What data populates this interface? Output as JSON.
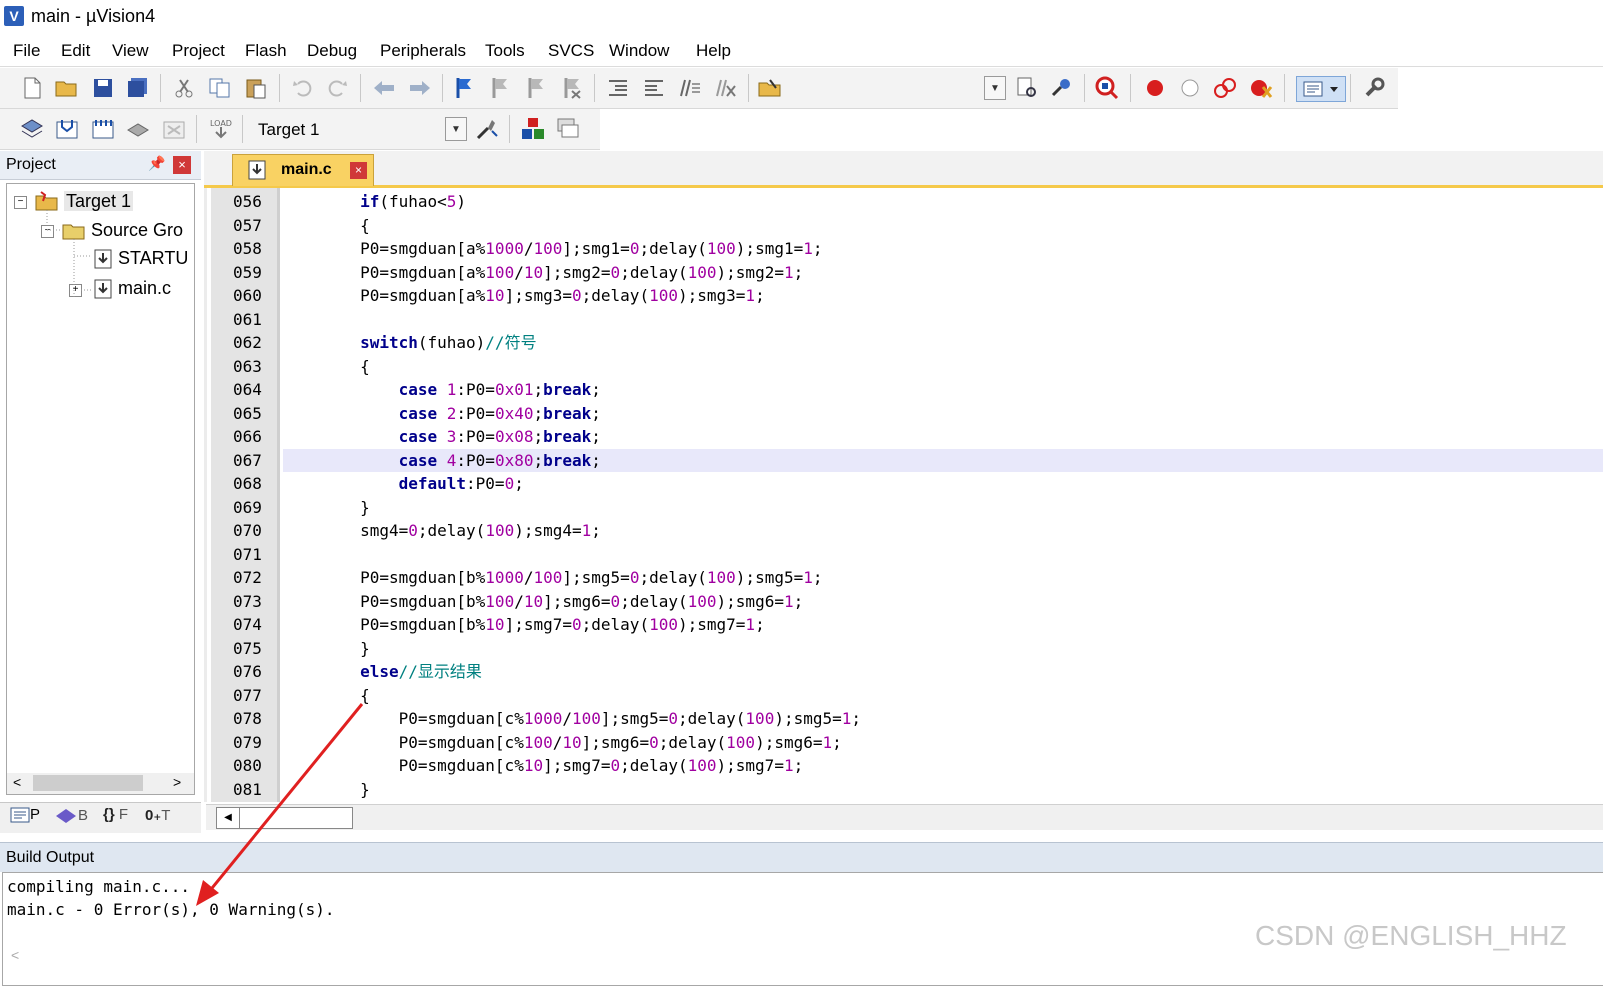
{
  "window": {
    "title": "main  - µVision4"
  },
  "menu": [
    "File",
    "Edit",
    "View",
    "Project",
    "Flash",
    "Debug",
    "Peripherals",
    "Tools",
    "SVCS",
    "Window",
    "Help"
  ],
  "toolbar2": {
    "target": "Target 1",
    "load_label": "LOAD"
  },
  "project_panel": {
    "title": "Project",
    "tree": [
      {
        "label": "Target 1"
      },
      {
        "label": "Source Gro"
      },
      {
        "label": "STARTU"
      },
      {
        "label": "main.c"
      }
    ],
    "tabs": [
      {
        "label": "P"
      },
      {
        "label": "B"
      },
      {
        "label": "F"
      },
      {
        "label": "T"
      }
    ]
  },
  "editor": {
    "tab_label": "main.c",
    "lines": [
      {
        "no": "056",
        "html": "        <span class=\"kw\">if</span>(fuhao&lt;<span class=\"num\">5</span>)"
      },
      {
        "no": "057",
        "html": "        {"
      },
      {
        "no": "058",
        "html": "        P0=smgduan[a%<span class=\"num\">1000</span>/<span class=\"num\">100</span>];smg1=<span class=\"num\">0</span>;delay(<span class=\"num\">100</span>);smg1=<span class=\"num\">1</span>;"
      },
      {
        "no": "059",
        "html": "        P0=smgduan[a%<span class=\"num\">100</span>/<span class=\"num\">10</span>];smg2=<span class=\"num\">0</span>;delay(<span class=\"num\">100</span>);smg2=<span class=\"num\">1</span>;"
      },
      {
        "no": "060",
        "html": "        P0=smgduan[a%<span class=\"num\">10</span>];smg3=<span class=\"num\">0</span>;delay(<span class=\"num\">100</span>);smg3=<span class=\"num\">1</span>;"
      },
      {
        "no": "061",
        "html": ""
      },
      {
        "no": "062",
        "html": "        <span class=\"kw\">switch</span>(fuhao)<span class=\"cm\">//符号</span>"
      },
      {
        "no": "063",
        "html": "        {"
      },
      {
        "no": "064",
        "html": "            <span class=\"kw\">case</span> <span class=\"num\">1</span>:P0=<span class=\"num\">0x01</span>;<span class=\"kw\">break</span>;"
      },
      {
        "no": "065",
        "html": "            <span class=\"kw\">case</span> <span class=\"num\">2</span>:P0=<span class=\"num\">0x40</span>;<span class=\"kw\">break</span>;"
      },
      {
        "no": "066",
        "html": "            <span class=\"kw\">case</span> <span class=\"num\">3</span>:P0=<span class=\"num\">0x08</span>;<span class=\"kw\">break</span>;"
      },
      {
        "no": "067",
        "html": "            <span class=\"kw\">case</span> <span class=\"num\">4</span>:P0=<span class=\"num\">0x80</span>;<span class=\"kw\">break</span>;",
        "highlight": true
      },
      {
        "no": "068",
        "html": "            <span class=\"kw\">default</span>:P0=<span class=\"num\">0</span>;"
      },
      {
        "no": "069",
        "html": "        }"
      },
      {
        "no": "070",
        "html": "        smg4=<span class=\"num\">0</span>;delay(<span class=\"num\">100</span>);smg4=<span class=\"num\">1</span>;"
      },
      {
        "no": "071",
        "html": ""
      },
      {
        "no": "072",
        "html": "        P0=smgduan[b%<span class=\"num\">1000</span>/<span class=\"num\">100</span>];smg5=<span class=\"num\">0</span>;delay(<span class=\"num\">100</span>);smg5=<span class=\"num\">1</span>;"
      },
      {
        "no": "073",
        "html": "        P0=smgduan[b%<span class=\"num\">100</span>/<span class=\"num\">10</span>];smg6=<span class=\"num\">0</span>;delay(<span class=\"num\">100</span>);smg6=<span class=\"num\">1</span>;"
      },
      {
        "no": "074",
        "html": "        P0=smgduan[b%<span class=\"num\">10</span>];smg7=<span class=\"num\">0</span>;delay(<span class=\"num\">100</span>);smg7=<span class=\"num\">1</span>;"
      },
      {
        "no": "075",
        "html": "        }"
      },
      {
        "no": "076",
        "html": "        <span class=\"kw\">else</span><span class=\"cm\">//显示结果</span>"
      },
      {
        "no": "077",
        "html": "        {"
      },
      {
        "no": "078",
        "html": "            P0=smgduan[c%<span class=\"num\">1000</span>/<span class=\"num\">100</span>];smg5=<span class=\"num\">0</span>;delay(<span class=\"num\">100</span>);smg5=<span class=\"num\">1</span>;"
      },
      {
        "no": "079",
        "html": "            P0=smgduan[c%<span class=\"num\">100</span>/<span class=\"num\">10</span>];smg6=<span class=\"num\">0</span>;delay(<span class=\"num\">100</span>);smg6=<span class=\"num\">1</span>;"
      },
      {
        "no": "080",
        "html": "            P0=smgduan[c%<span class=\"num\">10</span>];smg7=<span class=\"num\">0</span>;delay(<span class=\"num\">100</span>);smg7=<span class=\"num\">1</span>;"
      },
      {
        "no": "081",
        "html": "        }"
      }
    ]
  },
  "build_output": {
    "title": "Build Output",
    "lines": [
      "compiling main.c...",
      "main.c - 0 Error(s), 0 Warning(s)."
    ]
  },
  "watermark": "CSDN @ENGLISH_HHZ",
  "colors": {
    "keyword": "#00008b",
    "number": "#a000a0",
    "comment": "#008080",
    "tab_active": "#f9d263",
    "line_highlight": "#e8e8fa",
    "annotation_arrow": "#e02020"
  }
}
